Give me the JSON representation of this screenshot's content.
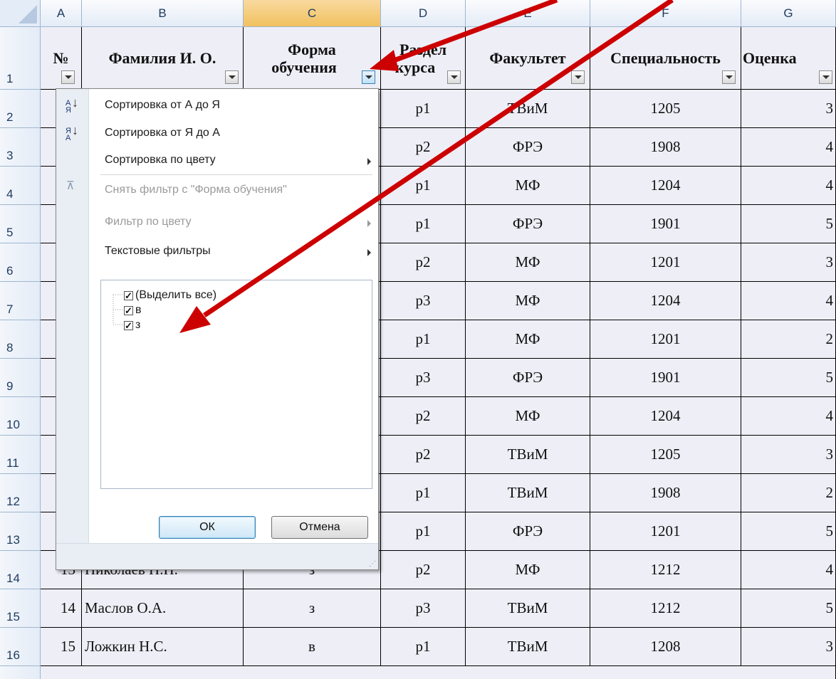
{
  "columns": [
    "A",
    "B",
    "C",
    "D",
    "E",
    "F",
    "G"
  ],
  "row_numbers": [
    "1",
    "2",
    "3",
    "4",
    "5",
    "6",
    "7",
    "8",
    "9",
    "10",
    "11",
    "12",
    "13",
    "14",
    "15",
    "16"
  ],
  "headers": {
    "num": "№",
    "name": "Фамилия И. О.",
    "form_line1": "Форма",
    "form_line2": "обучения",
    "section_line1": "Раздел",
    "section_line2": "курса",
    "faculty": "Факультет",
    "specialty": "Специальность",
    "grade": "Оценка"
  },
  "visible_rows": [
    {
      "section": "р1",
      "faculty": "ТВиМ",
      "specialty": "1205",
      "grade": "3"
    },
    {
      "section": "р2",
      "faculty": "ФРЭ",
      "specialty": "1908",
      "grade": "4"
    },
    {
      "section": "р1",
      "faculty": "МФ",
      "specialty": "1204",
      "grade": "4"
    },
    {
      "section": "р1",
      "faculty": "ФРЭ",
      "specialty": "1901",
      "grade": "5"
    },
    {
      "section": "р2",
      "faculty": "МФ",
      "specialty": "1201",
      "grade": "3"
    },
    {
      "section": "р3",
      "faculty": "МФ",
      "specialty": "1204",
      "grade": "4"
    },
    {
      "section": "р1",
      "faculty": "МФ",
      "specialty": "1201",
      "grade": "2"
    },
    {
      "section": "р3",
      "faculty": "ФРЭ",
      "specialty": "1901",
      "grade": "5"
    },
    {
      "section": "р2",
      "faculty": "МФ",
      "specialty": "1204",
      "grade": "4"
    },
    {
      "section": "р2",
      "faculty": "ТВиМ",
      "specialty": "1205",
      "grade": "3"
    },
    {
      "section": "р1",
      "faculty": "ТВиМ",
      "specialty": "1908",
      "grade": "2"
    },
    {
      "section": "р1",
      "faculty": "ФРЭ",
      "specialty": "1201",
      "grade": "5"
    },
    {
      "num": "13",
      "name": "Николаев Н.Н.",
      "form": "з",
      "section": "р2",
      "faculty": "МФ",
      "specialty": "1212",
      "grade": "4"
    },
    {
      "num": "14",
      "name": "Маслов О.А.",
      "form": "з",
      "section": "р3",
      "faculty": "ТВиМ",
      "specialty": "1212",
      "grade": "5"
    },
    {
      "num": "15",
      "name": "Ложкин Н.С.",
      "form": "в",
      "section": "р1",
      "faculty": "ТВиМ",
      "specialty": "1208",
      "grade": "3"
    }
  ],
  "filter_menu": {
    "sort_az": "Сортировка от А до Я",
    "sort_za": "Сортировка от Я до А",
    "sort_color": "Сортировка по цвету",
    "clear_filter": "Снять фильтр с \"Форма обучения\"",
    "filter_color": "Фильтр по цвету",
    "text_filters": "Текстовые фильтры",
    "list": [
      {
        "label": "(Выделить все)",
        "checked": true
      },
      {
        "label": "в",
        "checked": true
      },
      {
        "label": "з",
        "checked": true
      }
    ],
    "ok": "ОК",
    "cancel": "Отмена"
  },
  "colors": {
    "arrow": "#d00000",
    "cell_fill": "#eeeef7",
    "header_blue": "#e4ecf7"
  }
}
